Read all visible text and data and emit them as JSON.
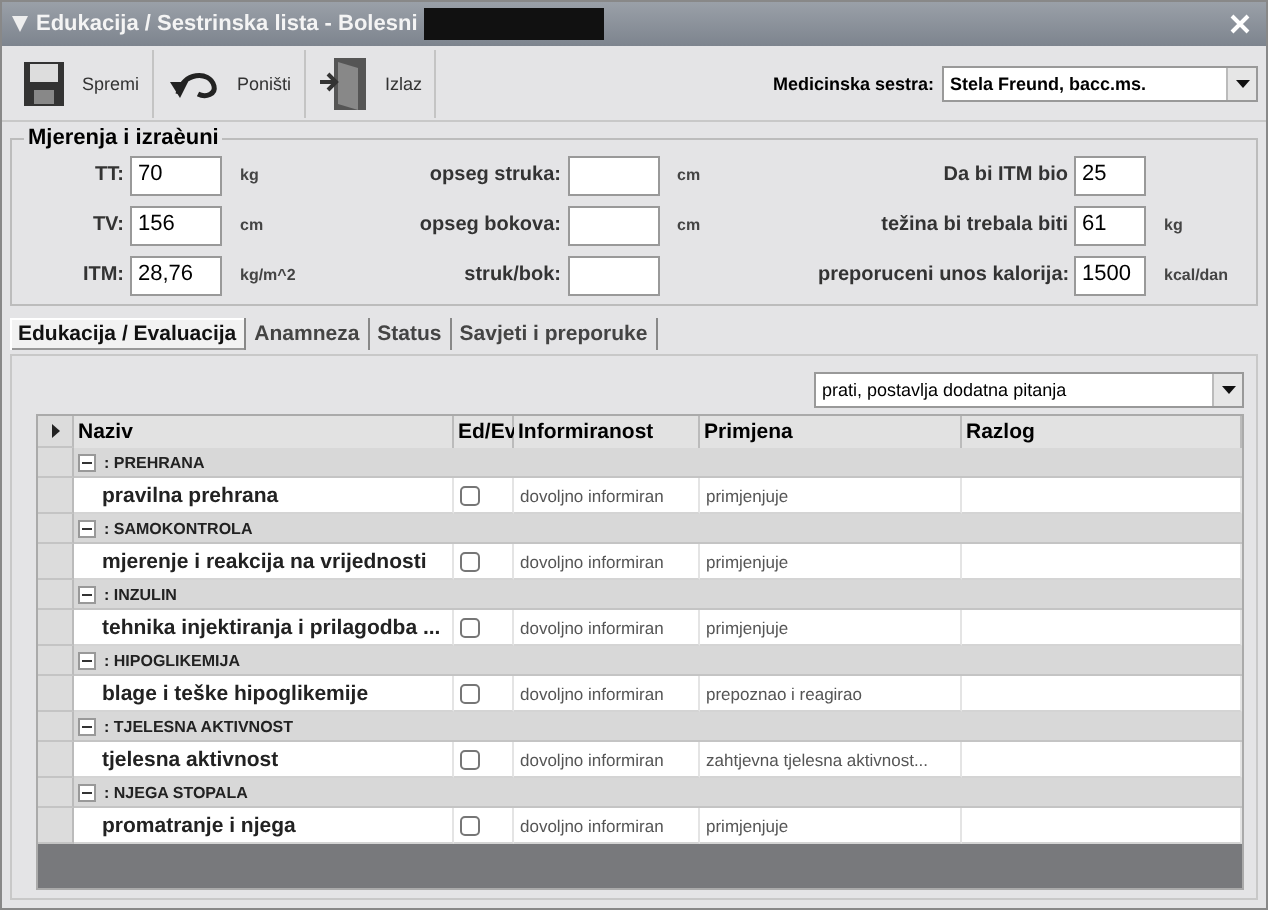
{
  "window": {
    "title": "Edukacija / Sestrinska lista - Bolesni"
  },
  "toolbar": {
    "buttons": [
      {
        "kind": "save",
        "label": "Spremi"
      },
      {
        "kind": "undo",
        "label": "Poništi"
      },
      {
        "kind": "exit",
        "label": "Izlaz"
      }
    ],
    "nurse": {
      "label": "Medicinska sestra:",
      "value": "Stela Freund, bacc.ms."
    }
  },
  "measurements": {
    "title": "Mjerenja i izraèuni",
    "columns": [
      [
        {
          "label": "TT:",
          "value": "70",
          "unit": "kg"
        },
        {
          "label": "TV:",
          "value": "156",
          "unit": "cm"
        },
        {
          "label": "ITM:",
          "value": "28,76",
          "unit": "kg/m^2"
        }
      ],
      [
        {
          "label": "opseg struka:",
          "unit": "cm"
        },
        {
          "label": "opseg bokova:",
          "unit": "cm"
        },
        {
          "label": "struk/bok:"
        }
      ],
      [
        {
          "label": "Da bi ITM bio",
          "value": "25"
        },
        {
          "label": "težina bi trebala biti",
          "value": "61",
          "unit": "kg"
        },
        {
          "label": "preporuceni unos kalorija:",
          "value": "1500",
          "unit": "kcal/dan"
        }
      ]
    ]
  },
  "tabs": [
    {
      "label": "Edukacija / Evaluacija",
      "selected": true
    },
    {
      "label": "Anamneza",
      "selected": false
    },
    {
      "label": "Status",
      "selected": false
    },
    {
      "label": "Savjeti i preporuke",
      "selected": false
    }
  ],
  "filter": {
    "value": "prati, postavlja dodatna pitanja"
  },
  "grid": {
    "columns": [
      "Naziv",
      "Ed/Ev",
      "Informiranost",
      "Primjena",
      "Razlog"
    ],
    "groups": [
      {
        "name": ": PREHRANA",
        "expanded": true,
        "items": [
          {
            "name": "pravilna prehrana",
            "checked": false,
            "informiranost": "dovoljno informiran",
            "primjena": "primjenjuje"
          }
        ]
      },
      {
        "name": ": SAMOKONTROLA",
        "expanded": true,
        "items": [
          {
            "name": "mjerenje i reakcija na vrijednosti",
            "checked": false,
            "informiranost": "dovoljno informiran",
            "primjena": "primjenjuje"
          }
        ]
      },
      {
        "name": ": INZULIN",
        "expanded": true,
        "items": [
          {
            "name": "tehnika injektiranja i prilagodba ...",
            "checked": false,
            "informiranost": "dovoljno informiran",
            "primjena": "primjenjuje"
          }
        ]
      },
      {
        "name": ": HIPOGLIKEMIJA",
        "expanded": true,
        "items": [
          {
            "name": "blage i teške hipoglikemije",
            "checked": false,
            "informiranost": "dovoljno informiran",
            "primjena": "prepoznao i reagirao"
          }
        ]
      },
      {
        "name": ": TJELESNA AKTIVNOST",
        "expanded": true,
        "items": [
          {
            "name": "tjelesna aktivnost",
            "checked": false,
            "informiranost": "dovoljno informiran",
            "primjena": "zahtjevna tjelesna aktivnost..."
          }
        ]
      },
      {
        "name": ": NJEGA STOPALA",
        "expanded": true,
        "items": [
          {
            "name": "promatranje i njega",
            "checked": false,
            "informiranost": "dovoljno informiran",
            "primjena": "primjenjuje"
          }
        ]
      }
    ]
  }
}
